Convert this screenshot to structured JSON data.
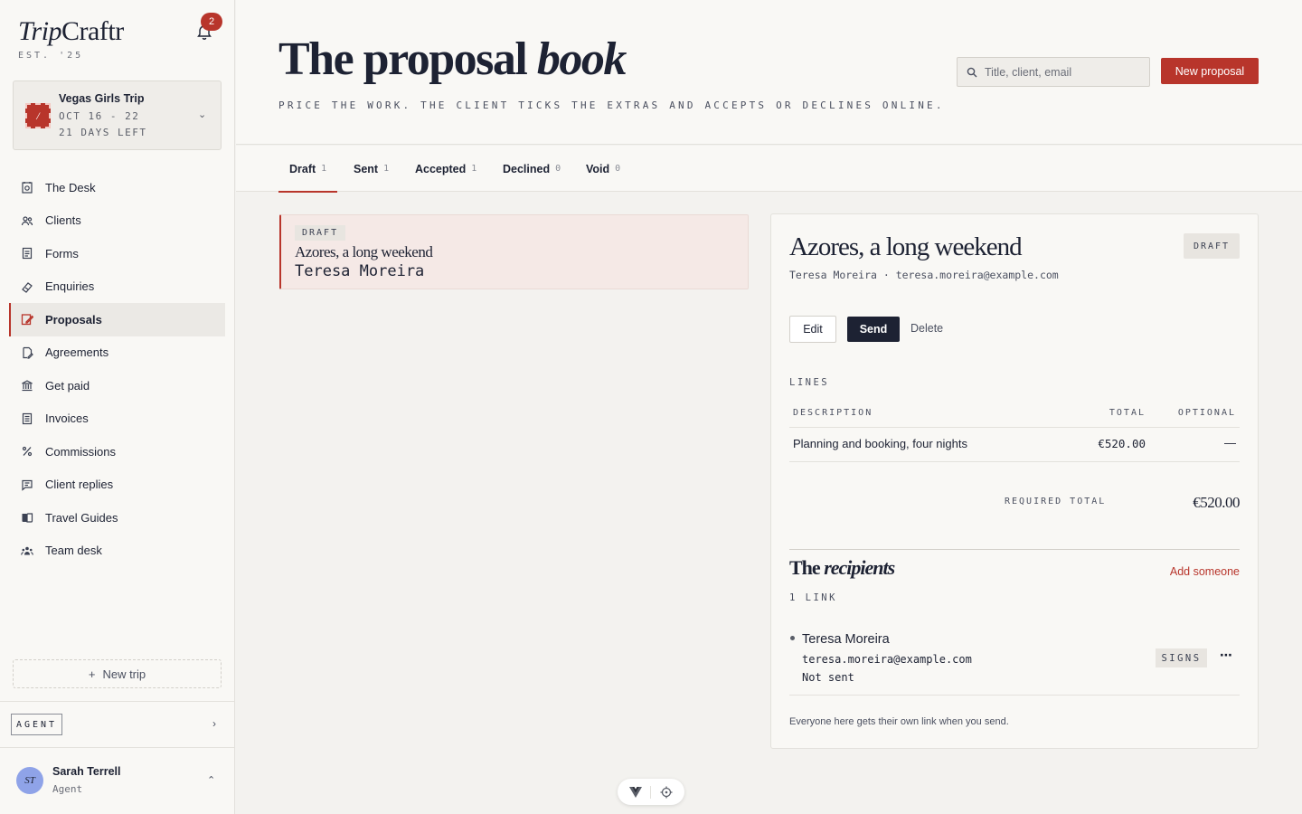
{
  "brand": {
    "name_regular": "Trip",
    "name_italic": "Craftr",
    "est": "EST. '25",
    "notifications": "2"
  },
  "trip": {
    "name": "Vegas Girls Trip",
    "dates": "OCT 16 - 22",
    "days_left": "21 DAYS LEFT",
    "stamp": "/"
  },
  "nav": [
    {
      "label": "The Desk",
      "icon": "desk-icon"
    },
    {
      "label": "Clients",
      "icon": "clients-icon"
    },
    {
      "label": "Forms",
      "icon": "forms-icon"
    },
    {
      "label": "Enquiries",
      "icon": "enquiries-icon"
    },
    {
      "label": "Proposals",
      "icon": "proposals-icon",
      "active": true
    },
    {
      "label": "Agreements",
      "icon": "agreements-icon"
    },
    {
      "label": "Get paid",
      "icon": "bank-icon"
    },
    {
      "label": "Invoices",
      "icon": "invoices-icon"
    },
    {
      "label": "Commissions",
      "icon": "percent-icon"
    },
    {
      "label": "Client replies",
      "icon": "message-icon"
    },
    {
      "label": "Travel Guides",
      "icon": "book-icon"
    },
    {
      "label": "Team desk",
      "icon": "team-icon"
    }
  ],
  "sidebar_footer": {
    "new_trip": "New trip",
    "agent_button": "AGENT",
    "user_initials": "ST",
    "user_name": "Sarah Terrell",
    "user_role": "Agent"
  },
  "header": {
    "title_regular": "The proposal ",
    "title_italic": "book",
    "subtitle": "PRICE THE WORK. THE CLIENT TICKS THE EXTRAS AND ACCEPTS OR DECLINES ONLINE.",
    "search_placeholder": "Title, client, email",
    "new_proposal": "New proposal"
  },
  "tabs": [
    {
      "label": "Draft",
      "count": "1",
      "active": true
    },
    {
      "label": "Sent",
      "count": "1"
    },
    {
      "label": "Accepted",
      "count": "1"
    },
    {
      "label": "Declined",
      "count": "0"
    },
    {
      "label": "Void",
      "count": "0"
    }
  ],
  "list": [
    {
      "status": "DRAFT",
      "title": "Azores, a long weekend",
      "client": "Teresa Moreira"
    }
  ],
  "detail": {
    "title": "Azores, a long weekend",
    "status": "DRAFT",
    "meta": "Teresa Moreira · teresa.moreira@example.com",
    "edit": "Edit",
    "send": "Send",
    "delete": "Delete",
    "lines_label": "LINES",
    "columns": {
      "description": "DESCRIPTION",
      "total": "TOTAL",
      "optional": "OPTIONAL"
    },
    "lines": [
      {
        "description": "Planning and booking, four nights",
        "total": "€520.00",
        "optional": "—"
      }
    ],
    "required_total_label": "REQUIRED TOTAL",
    "required_total": "€520.00",
    "recipients_title_regular": "The ",
    "recipients_title_italic": "recipients",
    "add_someone": "Add someone",
    "link_count": "1 LINK",
    "recipients": [
      {
        "name": "Teresa Moreira",
        "email": "teresa.moreira@example.com",
        "status": "Not sent",
        "role": "SIGNS"
      }
    ],
    "footnote": "Everyone here gets their own link when you send."
  },
  "colors": {
    "accent": "#b8352b",
    "ink": "#1d2233",
    "paper": "#f9f8f5"
  }
}
